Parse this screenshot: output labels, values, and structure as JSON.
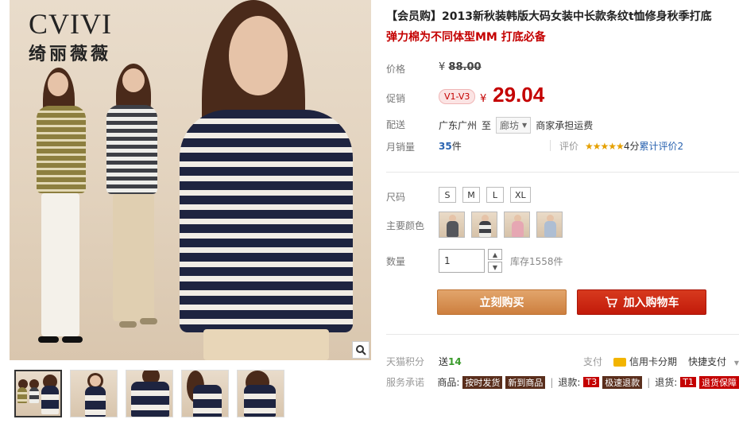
{
  "gallery": {
    "brand_latin": "CVIVI",
    "brand_cn": "绮丽薇薇",
    "zoom_icon": "magnifier-icon",
    "thumbnails": [
      {
        "style": "three-models",
        "active": true
      },
      {
        "style": "navy-stripe-front",
        "active": false
      },
      {
        "style": "navy-stripe-wide",
        "active": false
      },
      {
        "style": "navy-stripe-side",
        "active": false
      },
      {
        "style": "navy-stripe-back",
        "active": false
      }
    ]
  },
  "product": {
    "title": "【会员购】2013新秋装韩版大码女装中长款条纹t恤修身秋季打底",
    "subtitle": "弹力棉为不同体型MM 打底必备"
  },
  "price": {
    "label": "价格",
    "currency": "¥",
    "original": "88.00"
  },
  "promo": {
    "label": "促销",
    "badge": "V1-V3",
    "currency": "¥",
    "price": "29.04"
  },
  "shipping": {
    "label": "配送",
    "from": "广东广州",
    "to_label": "至",
    "to": "廊坊",
    "fee_text": "商家承担运费"
  },
  "sales": {
    "label": "月销量",
    "count": "35",
    "unit": "件",
    "rating_label": "评价",
    "stars": "★★★★★",
    "score_text": "4分",
    "review_text": "累计评价2"
  },
  "options": {
    "size_label": "尺码",
    "sizes": [
      "S",
      "M",
      "L",
      "XL"
    ],
    "color_label": "主要颜色",
    "colors": [
      "dark-grey",
      "grey-stripe",
      "pink",
      "light-blue"
    ]
  },
  "quantity": {
    "label": "数量",
    "value": "1",
    "stock_text": "库存1558件"
  },
  "buttons": {
    "buy_now": "立刻购买",
    "add_to_cart": "加入购物车",
    "cart_icon": "cart-icon"
  },
  "points": {
    "label": "天猫积分",
    "send_text": "送",
    "value": "14",
    "pay_label": "支付",
    "card_text": "信用卡分期",
    "quick_pay": "快捷支付"
  },
  "service": {
    "label": "服务承诺",
    "goods_label": "商品:",
    "tag_timely": "按时发货",
    "tag_new": "新到商品",
    "refund_label": "退款:",
    "tag_t3": "T3",
    "tag_fast_refund": "极速退款",
    "return_label": "退货:",
    "tag_t1": "T1",
    "tag_return": "退货保障"
  },
  "colors": {
    "accent_red": "#c40000",
    "buy_button": "#d88a4b",
    "cart_button": "#cc2510",
    "link_blue": "#2a63b0"
  }
}
